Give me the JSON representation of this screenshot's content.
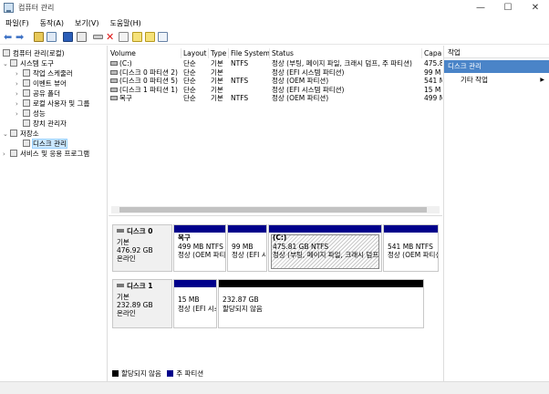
{
  "window": {
    "title": "컴퓨터 관리",
    "minimize": "—",
    "maximize": "☐",
    "close": "✕"
  },
  "menu": [
    "파일(F)",
    "동작(A)",
    "보기(V)",
    "도움말(H)"
  ],
  "tree": [
    {
      "label": "컴퓨터 관리(로컬)",
      "exp": "",
      "icon": "computer-icon"
    },
    {
      "label": "시스템 도구",
      "exp": "⌄",
      "icon": "tools-icon"
    },
    {
      "label": "작업 스케줄러",
      "exp": "›",
      "icon": "clock-icon"
    },
    {
      "label": "이벤트 뷰어",
      "exp": "›",
      "icon": "event-viewer-icon"
    },
    {
      "label": "공유 폴더",
      "exp": "›",
      "icon": "shared-folder-icon"
    },
    {
      "label": "로컬 사용자 및 그룹",
      "exp": "›",
      "icon": "users-icon"
    },
    {
      "label": "성능",
      "exp": "›",
      "icon": "performance-icon"
    },
    {
      "label": "장치 관리자",
      "exp": "",
      "icon": "device-manager-icon"
    },
    {
      "label": "저장소",
      "exp": "⌄",
      "icon": "storage-icon"
    },
    {
      "label": "디스크 관리",
      "exp": "",
      "icon": "disk-management-icon"
    },
    {
      "label": "서비스 및 응용 프로그램",
      "exp": "›",
      "icon": "services-icon"
    }
  ],
  "volume_table": {
    "headers": [
      "Volume",
      "Layout",
      "Type",
      "File System",
      "Status",
      "Capa"
    ],
    "rows": [
      [
        "(C:)",
        "단순",
        "기본",
        "NTFS",
        "정상 (부팅, 페이지 파일, 크래시 덤프, 주 파티션)",
        "475.8"
      ],
      [
        "(디스크 0 파티션 2)",
        "단순",
        "기본",
        "",
        "정상 (EFI 시스템 파티션)",
        "99 M"
      ],
      [
        "(디스크 0 파티션 5)",
        "단순",
        "기본",
        "NTFS",
        "정상 (OEM 파티션)",
        "541 M"
      ],
      [
        "(디스크 1 파티션 1)",
        "단순",
        "기본",
        "",
        "정상 (EFI 시스템 파티션)",
        "15 M"
      ],
      [
        "복구",
        "단순",
        "기본",
        "NTFS",
        "정상 (OEM 파티션)",
        "499 M"
      ]
    ]
  },
  "disks": [
    {
      "name": "디스크 0",
      "type": "기본",
      "size": "476.92 GB",
      "state": "온라인",
      "partitions": [
        {
          "name": "복구",
          "size": "499 MB NTFS",
          "status": "정상 (OEM 파티션)"
        },
        {
          "name": "",
          "size": "99 MB",
          "status": "정상 (EFI 시스템"
        },
        {
          "name": "(C:)",
          "size": "475.81 GB NTFS",
          "status": "정상 (부팅, 페이지 파일, 크래시 덤프"
        },
        {
          "name": "",
          "size": "541 MB NTFS",
          "status": "정상 (OEM 파티션)"
        }
      ]
    },
    {
      "name": "디스크 1",
      "type": "기본",
      "size": "232.89 GB",
      "state": "온라인",
      "partitions": [
        {
          "name": "",
          "size": "15 MB",
          "status": "정상 (EFI 시스"
        },
        {
          "name": "",
          "size": "232.87 GB",
          "status": "할당되지 않음"
        }
      ]
    }
  ],
  "legend": [
    "할당되지 않음",
    "주 파티션"
  ],
  "actions": {
    "header": "작업",
    "section": "디스크 관리",
    "item": "기타 작업",
    "arrow": "▶"
  },
  "colors": {
    "primary_partition": "#00008b",
    "unallocated": "#000000",
    "accent": "#4a84c8"
  }
}
